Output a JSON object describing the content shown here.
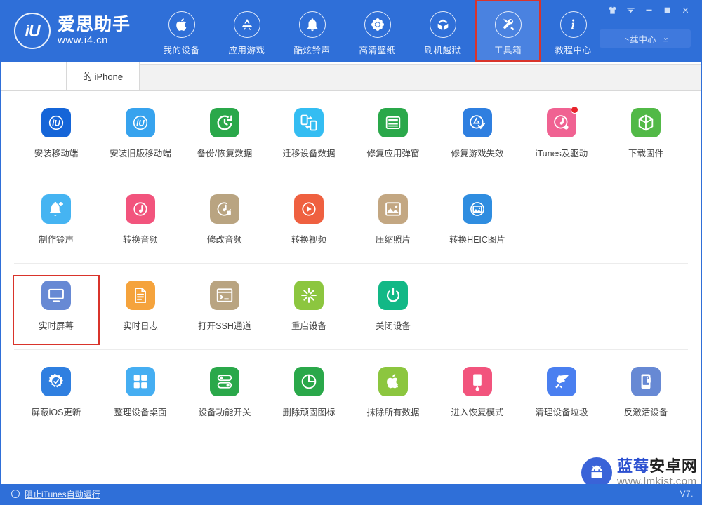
{
  "app": {
    "brand_initials": "iU",
    "brand_name": "爱思助手",
    "brand_url": "www.i4.cn"
  },
  "header": {
    "nav": [
      {
        "label": "我的设备",
        "icon": "apple-icon",
        "active": false,
        "highlight": false
      },
      {
        "label": "应用游戏",
        "icon": "appstore-icon",
        "active": false,
        "highlight": false
      },
      {
        "label": "酷炫铃声",
        "icon": "bell-icon",
        "active": false,
        "highlight": false
      },
      {
        "label": "高清壁纸",
        "icon": "flower-icon",
        "active": false,
        "highlight": false
      },
      {
        "label": "刷机越狱",
        "icon": "openbox-icon",
        "active": false,
        "highlight": false
      },
      {
        "label": "工具箱",
        "icon": "tools-icon",
        "active": true,
        "highlight": true
      },
      {
        "label": "教程中心",
        "icon": "info-icon",
        "active": false,
        "highlight": false
      }
    ],
    "window_controls": [
      {
        "name": "skin-icon"
      },
      {
        "name": "chevron-down-icon"
      },
      {
        "name": "minimize-icon"
      },
      {
        "name": "maximize-icon"
      },
      {
        "name": "close-icon"
      }
    ],
    "download_center": {
      "label": "下载中心",
      "icon": "download-icon"
    }
  },
  "tabs": [
    {
      "label": "的 iPhone",
      "active": true
    }
  ],
  "tool_rows": [
    [
      {
        "label": "安装移动端",
        "icon": "iu-logo-icon",
        "color": "#1565d8",
        "badge": false,
        "selected": false
      },
      {
        "label": "安装旧版移动端",
        "icon": "iu-logo-icon",
        "color": "#37a3ee",
        "badge": false,
        "selected": false
      },
      {
        "label": "备份/恢复数据",
        "icon": "restore-icon",
        "color": "#2aa84a",
        "badge": false,
        "selected": false
      },
      {
        "label": "迁移设备数据",
        "icon": "transfer-icon",
        "color": "#34bdf2",
        "badge": false,
        "selected": false
      },
      {
        "label": "修复应用弹窗",
        "icon": "appleid-card-icon",
        "color": "#2aa84a",
        "badge": false,
        "selected": false
      },
      {
        "label": "修复游戏失效",
        "icon": "appstore-check-icon",
        "color": "#2f7fe0",
        "badge": false,
        "selected": false
      },
      {
        "label": "iTunes及驱动",
        "icon": "itunes-gear-icon",
        "color": "#f06292",
        "badge": true,
        "selected": false
      },
      {
        "label": "下载固件",
        "icon": "cube-icon",
        "color": "#52b947",
        "badge": false,
        "selected": false
      }
    ],
    [
      {
        "label": "制作铃声",
        "icon": "bell-plus-icon",
        "color": "#45b4f2",
        "badge": false,
        "selected": false
      },
      {
        "label": "转换音频",
        "icon": "music-note-icon",
        "color": "#f2547d",
        "badge": false,
        "selected": false
      },
      {
        "label": "修改音频",
        "icon": "music-edit-icon",
        "color": "#b9a481",
        "badge": false,
        "selected": false
      },
      {
        "label": "转换视频",
        "icon": "play-icon",
        "color": "#ef6040",
        "badge": false,
        "selected": false
      },
      {
        "label": "压缩照片",
        "icon": "photo-icon",
        "color": "#c3a782",
        "badge": false,
        "selected": false
      },
      {
        "label": "转换HEIC图片",
        "icon": "photo-circle-icon",
        "color": "#2f8de0",
        "badge": false,
        "selected": false
      }
    ],
    [
      {
        "label": "实时屏幕",
        "icon": "monitor-icon",
        "color": "#6789d4",
        "badge": false,
        "selected": true
      },
      {
        "label": "实时日志",
        "icon": "document-icon",
        "color": "#f5a33c",
        "badge": false,
        "selected": false
      },
      {
        "label": "打开SSH通道",
        "icon": "terminal-icon",
        "color": "#b9a481",
        "badge": false,
        "selected": false
      },
      {
        "label": "重启设备",
        "icon": "restart-icon",
        "color": "#8cc63f",
        "badge": false,
        "selected": false
      },
      {
        "label": "关闭设备",
        "icon": "power-icon",
        "color": "#12b886",
        "badge": false,
        "selected": false
      }
    ],
    [
      {
        "label": "屏蔽iOS更新",
        "icon": "gear-block-icon",
        "color": "#2f7fe0",
        "badge": false,
        "selected": false
      },
      {
        "label": "整理设备桌面",
        "icon": "grid-icon",
        "color": "#45aef2",
        "badge": false,
        "selected": false
      },
      {
        "label": "设备功能开关",
        "icon": "toggles-icon",
        "color": "#2aa84a",
        "badge": false,
        "selected": false
      },
      {
        "label": "删除顽固图标",
        "icon": "pie-icon",
        "color": "#2aa84a",
        "badge": false,
        "selected": false
      },
      {
        "label": "抹除所有数据",
        "icon": "apple-erase-icon",
        "color": "#8cc63f",
        "badge": false,
        "selected": false
      },
      {
        "label": "进入恢复模式",
        "icon": "phone-drop-icon",
        "color": "#f2547d",
        "badge": false,
        "selected": false
      },
      {
        "label": "清理设备垃圾",
        "icon": "broom-icon",
        "color": "#4a7ff0",
        "badge": false,
        "selected": false
      },
      {
        "label": "反激活设备",
        "icon": "phone-lock-icon",
        "color": "#6789d4",
        "badge": false,
        "selected": false
      }
    ]
  ],
  "statusbar": {
    "checkbox_label": "阻止iTunes自动运行",
    "checked": false,
    "version": "V7."
  },
  "watermark": {
    "title_blue": "蓝莓",
    "title_black": "安卓网",
    "url": "www.lmkjst.com"
  },
  "colors": {
    "header_blue": "#2f6fd8",
    "active_nav": "#4a82e0",
    "highlight_red": "#d9342b"
  }
}
